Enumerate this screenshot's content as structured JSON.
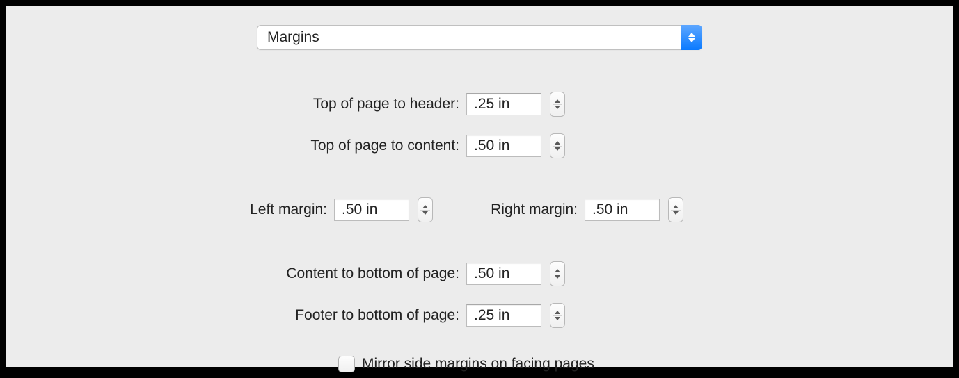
{
  "dropdown": {
    "selected": "Margins"
  },
  "fields": {
    "top_to_header": {
      "label": "Top of page to header:",
      "value": ".25 in"
    },
    "top_to_content": {
      "label": "Top of page to content:",
      "value": ".50 in"
    },
    "left_margin": {
      "label": "Left margin:",
      "value": ".50 in"
    },
    "right_margin": {
      "label": "Right margin:",
      "value": ".50 in"
    },
    "content_to_bottom": {
      "label": "Content to bottom of page:",
      "value": ".50 in"
    },
    "footer_to_bottom": {
      "label": "Footer to bottom of page:",
      "value": ".25 in"
    }
  },
  "checkbox": {
    "mirror_label": "Mirror side margins on facing pages",
    "mirror_checked": false
  }
}
